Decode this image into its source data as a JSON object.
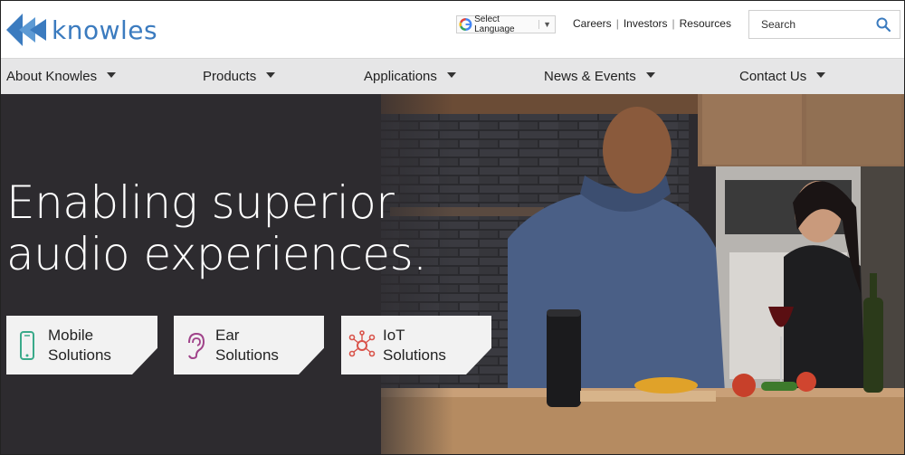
{
  "brand": {
    "logo_text": "knowles",
    "logo_color": "#3b7bbf"
  },
  "header": {
    "language_selector": "Select Language",
    "top_links": [
      "Careers",
      "Investors",
      "Resources"
    ],
    "search": {
      "placeholder": "Search",
      "icon": "search-icon"
    }
  },
  "nav": {
    "items": [
      {
        "label": "About Knowles"
      },
      {
        "label": "Products"
      },
      {
        "label": "Applications"
      },
      {
        "label": "News & Events"
      },
      {
        "label": "Contact Us"
      }
    ]
  },
  "hero": {
    "headline_line1": "Enabling superior",
    "headline_line2": "audio experiences.",
    "cards": [
      {
        "line1": "Mobile",
        "line2": "Solutions",
        "icon": "mobile-phone-icon",
        "icon_color": "#3aaa8a"
      },
      {
        "line1": "Ear",
        "line2": "Solutions",
        "icon": "ear-icon",
        "icon_color": "#a0438a"
      },
      {
        "line1": "IoT",
        "line2": "Solutions",
        "icon": "iot-network-icon",
        "icon_color": "#d9534a"
      }
    ]
  }
}
